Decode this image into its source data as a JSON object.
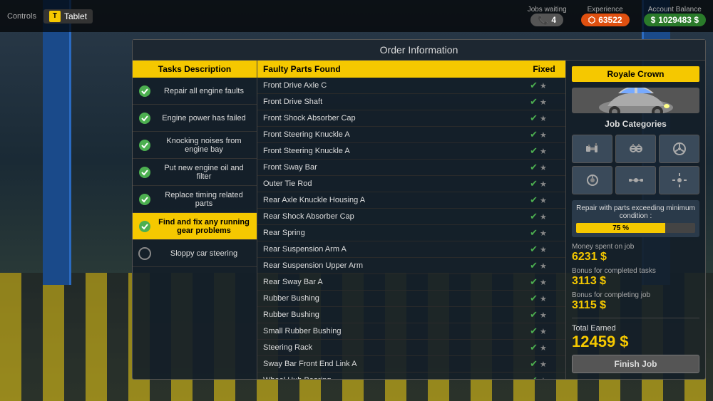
{
  "topBar": {
    "controls": "Controls",
    "tablet": "Tablet",
    "tabletKey": "T",
    "jobsWaiting": "Jobs waiting",
    "experience": "Experience",
    "accountBalance": "Account Balance",
    "jobsCount": "4",
    "xpValue": "63522",
    "moneyValue": "1029483 $"
  },
  "panel": {
    "title": "Order Information",
    "tasksHeader": "Tasks Description",
    "partsHeader": "Faulty Parts Found",
    "fixedHeader": "Fixed",
    "carHeader": "Royale Crown"
  },
  "tasks": [
    {
      "id": 1,
      "text": "Repair all engine faults",
      "done": true,
      "active": false
    },
    {
      "id": 2,
      "text": "Engine power has failed",
      "done": true,
      "active": false
    },
    {
      "id": 3,
      "text": "Knocking noises from engine bay",
      "done": true,
      "active": false
    },
    {
      "id": 4,
      "text": "Put new engine oil and filter",
      "done": true,
      "active": false
    },
    {
      "id": 5,
      "text": "Replace timing related parts",
      "done": true,
      "active": false
    },
    {
      "id": 6,
      "text": "Find and fix any running gear problems",
      "done": true,
      "active": true
    },
    {
      "id": 7,
      "text": "Sloppy car steering",
      "done": false,
      "active": false
    }
  ],
  "parts": [
    {
      "name": "Front Drive Axle C",
      "fixed": true
    },
    {
      "name": "Front Drive Shaft",
      "fixed": true
    },
    {
      "name": "Front Shock Absorber Cap",
      "fixed": true
    },
    {
      "name": "Front Steering Knuckle A",
      "fixed": true
    },
    {
      "name": "Front Steering Knuckle A",
      "fixed": true
    },
    {
      "name": "Front Sway Bar",
      "fixed": true
    },
    {
      "name": "Outer Tie Rod",
      "fixed": true
    },
    {
      "name": "Rear Axle Knuckle Housing A",
      "fixed": true
    },
    {
      "name": "Rear Shock Absorber Cap",
      "fixed": true
    },
    {
      "name": "Rear Spring",
      "fixed": true
    },
    {
      "name": "Rear Suspension Arm A",
      "fixed": true
    },
    {
      "name": "Rear Suspension Upper Arm",
      "fixed": true
    },
    {
      "name": "Rear Sway Bar A",
      "fixed": true
    },
    {
      "name": "Rubber Bushing",
      "fixed": true
    },
    {
      "name": "Rubber Bushing",
      "fixed": true
    },
    {
      "name": "Small Rubber Bushing",
      "fixed": true
    },
    {
      "name": "Steering Rack",
      "fixed": true
    },
    {
      "name": "Sway Bar Front End Link A",
      "fixed": true
    },
    {
      "name": "Wheel Hub Bearing",
      "fixed": true
    }
  ],
  "condition": {
    "label": "Repair with parts exceeding minimum condition :",
    "percent": "75 %",
    "barWidth": 75
  },
  "finances": {
    "moneySpentLabel": "Money spent on job",
    "moneySpent": "6231 $",
    "bonusTasksLabel": "Bonus for completed tasks",
    "bonusTasks": "3113 $",
    "bonusJobLabel": "Bonus for completing job",
    "bonusJob": "3115 $",
    "totalLabel": "Total Earned",
    "total": "12459 $",
    "finishBtn": "Finish Job"
  },
  "categories": [
    "⚙",
    "🔧",
    "🔩"
  ]
}
